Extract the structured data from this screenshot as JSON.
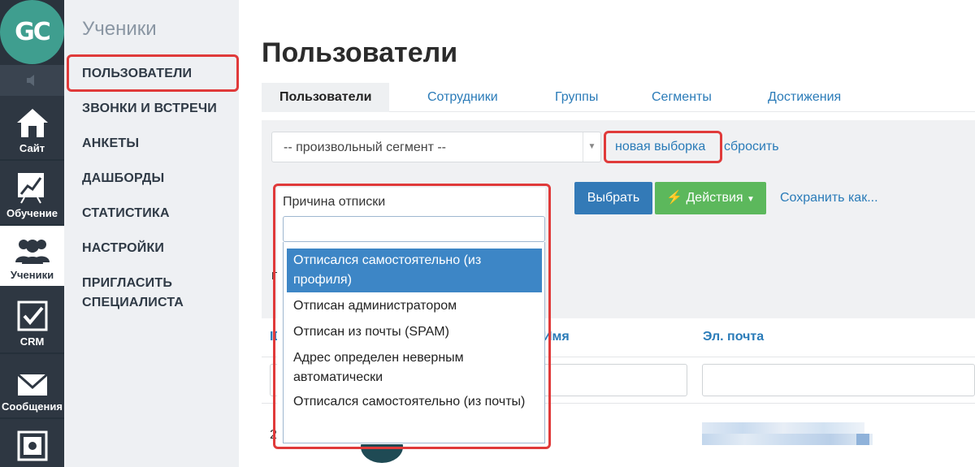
{
  "rail": {
    "logo": "GC",
    "items": [
      {
        "label": "Сайт",
        "icon": "home-icon"
      },
      {
        "label": "Обучение",
        "icon": "chart-icon"
      },
      {
        "label": "Ученики",
        "icon": "users-icon"
      },
      {
        "label": "CRM",
        "icon": "checkbox-icon"
      },
      {
        "label": "Сообщения",
        "icon": "envelope-icon"
      }
    ]
  },
  "subnav": {
    "title": "Ученики",
    "items": [
      "ПОЛЬЗОВАТЕЛИ",
      "ЗВОНКИ И ВСТРЕЧИ",
      "АНКЕТЫ",
      "ДАШБОРДЫ",
      "СТАТИСТИКА",
      "НАСТРОЙКИ",
      "ПРИГЛАСИТЬ",
      "СПЕЦИАЛИСТА"
    ]
  },
  "main": {
    "title": "Пользователи",
    "tabs": [
      "Пользователи",
      "Сотрудники",
      "Группы",
      "Сегменты",
      "Достижения"
    ],
    "segment_select": "-- произвольный сегмент --",
    "new_selection_link": "новая выборка",
    "reset_link": "сбросить",
    "select_button": "Выбрать",
    "actions_button": "Действия",
    "save_as_link": "Сохранить как...",
    "filter": {
      "label": "Причина отписки",
      "search_value": "",
      "options": [
        "Отписался самостоятельно (из профиля)",
        "Отписан администратором",
        "Отписан из почты (SPAM)",
        "Адрес определен неверным автоматически",
        "Отписался самостоятельно (из почты)"
      ],
      "selected_index": 0
    },
    "table": {
      "columns": [
        "ID",
        "Имя",
        "Эл. почта"
      ],
      "peek_id": "21"
    }
  },
  "colors": {
    "rail_bg": "#2e3742",
    "subnav_bg": "#eef0f3",
    "link_blue": "#2a7bb8",
    "highlight_red": "#e03a3a",
    "btn_blue": "#337ab7",
    "btn_green": "#5cb85c",
    "selected_option": "#3d86c6"
  }
}
